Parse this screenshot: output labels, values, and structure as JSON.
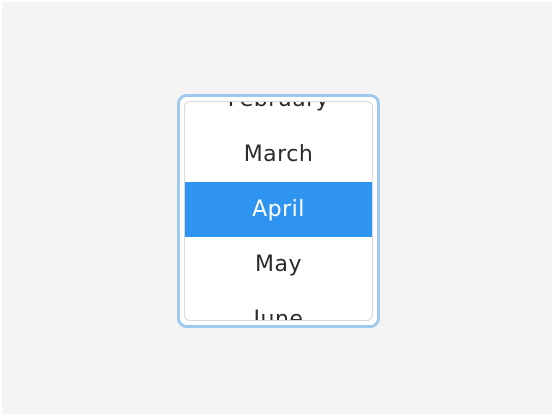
{
  "listbox": {
    "options": [
      {
        "label": "February",
        "selected": false
      },
      {
        "label": "March",
        "selected": false
      },
      {
        "label": "April",
        "selected": true
      },
      {
        "label": "May",
        "selected": false
      },
      {
        "label": "June",
        "selected": false
      }
    ],
    "selected_value": "April"
  },
  "colors": {
    "background": "#f4f4f4",
    "focus_border": "#9ec8ee",
    "selection_bg": "#2e94f0",
    "selection_text": "#ffffff",
    "option_text": "#2b2b2b"
  }
}
